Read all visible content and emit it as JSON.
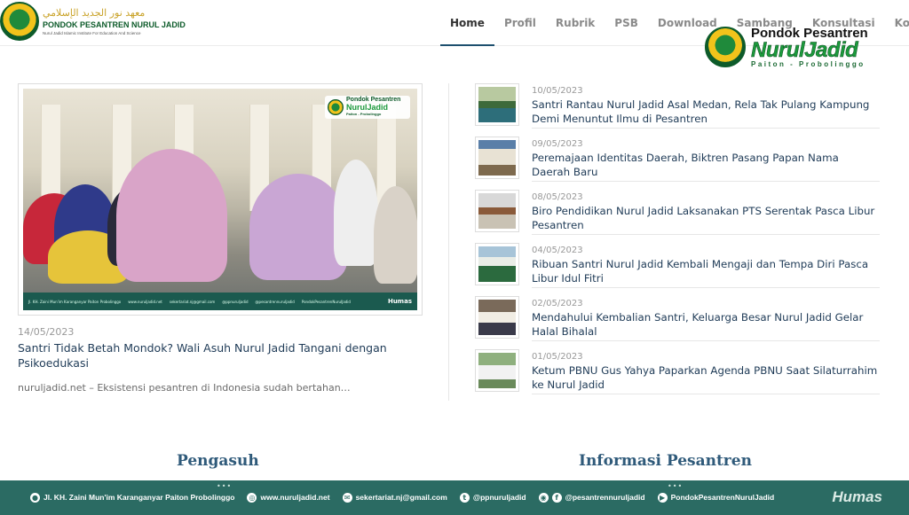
{
  "logo": {
    "arabic": "معهد نور الجديد الإسلامي",
    "name": "PONDOK PESANTREN NURUL JADID",
    "subtitle": "Nurul Jadid Islamic Institute For Education And Science"
  },
  "nav": {
    "items": [
      {
        "label": "Home",
        "active": true
      },
      {
        "label": "Profil"
      },
      {
        "label": "Rubrik"
      },
      {
        "label": "PSB"
      },
      {
        "label": "Download"
      },
      {
        "label": "Sambang"
      },
      {
        "label": "Konsultasi"
      },
      {
        "label": "Kontak"
      }
    ],
    "search_icon": "search-icon"
  },
  "brand": {
    "top": "Pondok Pesantren",
    "main": "NurulJadid",
    "bottom": "Paiton - Probolinggo"
  },
  "featured": {
    "photo_badge_top": "Pondok Pesantren",
    "photo_badge_main": "NurulJadid",
    "photo_badge_bottom": "Paiton - Probolinggo",
    "photo_strip": [
      "Jl. KH. Zaini Mun'im Karanganyar Paiton Probolinggo",
      "www.nuruljadid.net",
      "sekertariat.nj@gmail.com",
      "@ppnuruljadid",
      "@pesantrennuruljadid",
      "PondokPesantrenNurulJadid"
    ],
    "photo_humas": "Humas",
    "date": "14/05/2023",
    "title": "Santri Tidak Betah Mondok? Wali Asuh Nurul Jadid Tangani dengan Psikoedukasi",
    "excerpt": "nuruljadid.net – Eksistensi pesantren di Indonesia sudah bertahan…"
  },
  "news": [
    {
      "date": "10/05/2023",
      "title": "Santri Rantau Nurul Jadid Asal Medan, Rela Tak Pulang Kampung Demi Menuntut Ilmu di Pesantren"
    },
    {
      "date": "09/05/2023",
      "title": "Peremajaan Identitas Daerah, Biktren Pasang Papan Nama Daerah Baru"
    },
    {
      "date": "08/05/2023",
      "title": "Biro Pendidikan Nurul Jadid Laksanakan PTS Serentak Pasca Libur Pesantren"
    },
    {
      "date": "04/05/2023",
      "title": "Ribuan Santri Nurul Jadid Kembali Mengaji dan Tempa Diri Pasca Libur Idul Fitri"
    },
    {
      "date": "02/05/2023",
      "title": "Mendahului Kembalian Santri, Keluarga Besar Nurul Jadid Gelar Halal Bihalal"
    },
    {
      "date": "01/05/2023",
      "title": "Ketum PBNU Gus Yahya Paparkan Agenda PBNU Saat Silaturrahim ke Nurul Jadid"
    }
  ],
  "sections": {
    "left": "Pengasuh",
    "right": "Informasi Pesantren"
  },
  "footer": {
    "address": "Jl. KH. Zaini Mun'im Karanganyar Paiton Probolinggo",
    "website": "www.nuruljadid.net",
    "email": "sekertariat.nj@gmail.com",
    "twitter": "@ppnuruljadid",
    "instagram": "@pesantrennuruljadid",
    "youtube": "PondokPesantrenNurulJadid",
    "humas": "Humas"
  },
  "colors": {
    "accent": "#1d4f6e",
    "footer": "#2b6b63",
    "brand_green": "#1c9a3c"
  }
}
